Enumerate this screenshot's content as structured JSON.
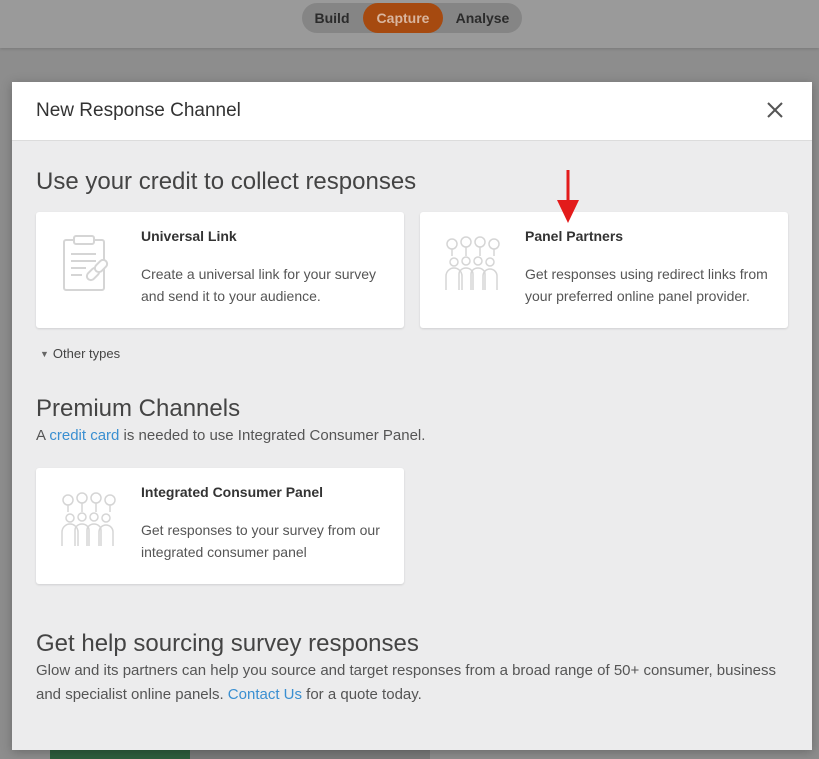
{
  "tabs": [
    {
      "label": "Build"
    },
    {
      "label": "Capture",
      "active": true
    },
    {
      "label": "Analyse"
    }
  ],
  "modal": {
    "title": "New Response Channel",
    "close_icon": "close-icon"
  },
  "section1": {
    "title": "Use your credit to collect responses",
    "cards": [
      {
        "title": "Universal Link",
        "desc": "Create a universal link for your survey and send it to your audience.",
        "icon": "clipboard-link-icon"
      },
      {
        "title": "Panel Partners",
        "desc": "Get responses using redirect links from your preferred online panel provider.",
        "icon": "people-panel-icon"
      }
    ],
    "other_types": "Other types"
  },
  "section2": {
    "title": "Premium Channels",
    "text_before": "A ",
    "link": "credit card",
    "text_after": " is needed to use Integrated Consumer Panel.",
    "card": {
      "title": "Integrated Consumer Panel",
      "desc": "Get responses to your survey from our integrated consumer panel",
      "icon": "people-panel-icon"
    }
  },
  "section3": {
    "title": "Get help sourcing survey responses",
    "text_before": "Glow and its partners can help you source and target responses from a broad range of 50+ consumer, business and specialist online panels. ",
    "link": "Contact Us",
    "text_after": " for a quote today."
  },
  "colors": {
    "accent": "#a64a10",
    "link": "#3a8fd1",
    "annotation_arrow": "#e31b1b"
  }
}
